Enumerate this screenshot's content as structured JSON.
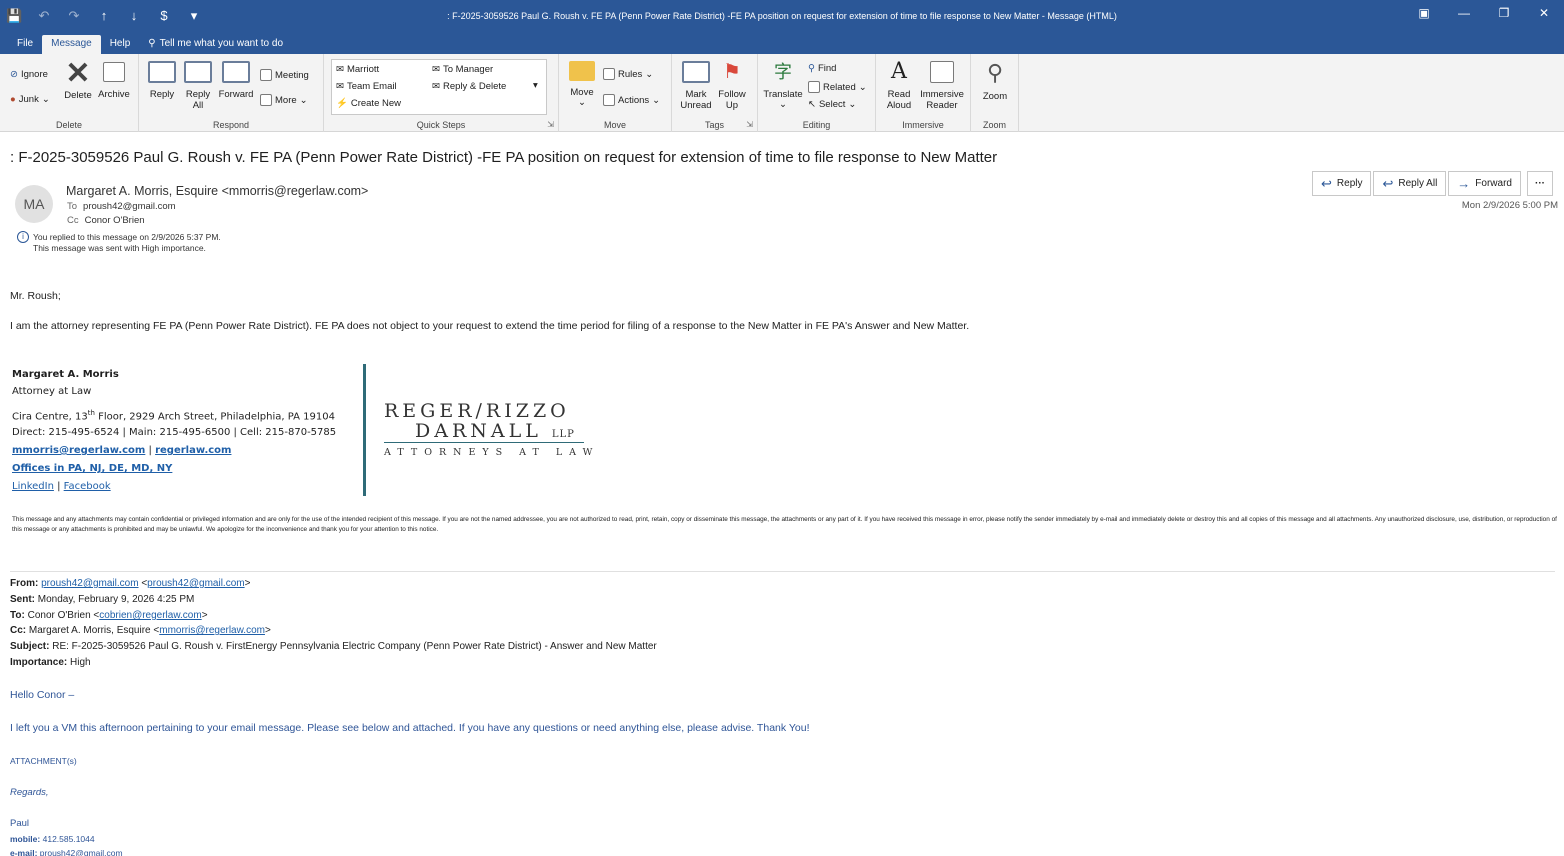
{
  "window": {
    "title": ": F-2025-3059526 Paul G. Roush v. FE PA (Penn Power Rate District) -FE PA position on  request for extension of time to file response to New Matter  -  Message (HTML)"
  },
  "tabs": [
    "File",
    "Message",
    "Help",
    "Tell me what you want to do"
  ],
  "ribbon": {
    "delete": {
      "ignore": "Ignore",
      "junk": "Junk",
      "delete": "Delete",
      "archive": "Archive",
      "label": "Delete"
    },
    "respond": {
      "reply": "Reply",
      "reply_all_1": "Reply",
      "reply_all_2": "All",
      "forward": "Forward",
      "meeting": "Meeting",
      "more": "More",
      "label": "Respond"
    },
    "quick_steps": {
      "marriott": "Marriott",
      "team_email": "Team Email",
      "create_new": "Create New",
      "to_manager": "To Manager",
      "reply_delete": "Reply & Delete",
      "label": "Quick Steps"
    },
    "move": {
      "move": "Move",
      "rules": "Rules",
      "actions": "Actions",
      "label": "Move"
    },
    "tags": {
      "mark_1": "Mark",
      "mark_2": "Unread",
      "follow_1": "Follow",
      "follow_2": "Up",
      "label": "Tags"
    },
    "editing": {
      "translate": "Translate",
      "find": "Find",
      "related": "Related",
      "select": "Select",
      "label": "Editing"
    },
    "immersive": {
      "read_1": "Read",
      "read_2": "Aloud",
      "imm_1": "Immersive",
      "imm_2": "Reader",
      "label": "Immersive"
    },
    "zoom": {
      "zoom": "Zoom",
      "label": "Zoom"
    }
  },
  "message": {
    "subject": ": F-2025-3059526 Paul G. Roush v. FE PA (Penn Power Rate District) -FE PA position on  request for extension of time to file response to New Matter",
    "avatar_initials": "MA",
    "sender": "Margaret A. Morris, Esquire <mmorris@regerlaw.com>",
    "to_label": "To",
    "to": "proush42@gmail.com",
    "cc_label": "Cc",
    "cc": "Conor O'Brien",
    "info_replied": "You replied to this message on 2/9/2026 5:37 PM.",
    "info_importance": "This message was sent with High importance.",
    "actions": {
      "reply": "Reply",
      "reply_all": "Reply All",
      "forward": "Forward",
      "more": "···"
    },
    "datetime": "Mon 2/9/2026 5:00 PM"
  },
  "body": {
    "greeting": "Mr. Roush;",
    "para1": "I am the attorney representing FE PA (Penn Power Rate District).  FE PA does not object to your request to extend the time period for filing of a response to the New Matter in FE PA's Answer and New Matter.",
    "signature": {
      "name": "Margaret A. Morris",
      "role": "Attorney at Law",
      "addr_pre": "Cira Centre, 13",
      "addr_sup": "th",
      "addr_post": " Floor, 2929 Arch Street, Philadelphia, PA 19104",
      "phones": "Direct: 215-495-6524 | Main: 215-495-6500 | Cell: 215-870-5785",
      "email": "mmorris@regerlaw.com",
      "sep": " | ",
      "site": "regerlaw.com",
      "offices": "Offices in PA, NJ, DE, MD, NY",
      "linkedin": "LinkedIn",
      "facebook": "Facebook"
    },
    "logo": {
      "line1": "REGER∕RIZZO",
      "line2": "DARNALL",
      "llp": "LLP",
      "line3": "ATTORNEYS AT LAW"
    },
    "disclaimer": "This message and any attachments may contain confidential or privileged information and are only for the use of the intended recipient of this message. If you are not the named addressee, you are not authorized to read, print, retain, copy or disseminate this message, the attachments or any part of it. If you have received this message in error, please notify the sender immediately by e-mail and immediately delete or destroy this and all copies of this message and all attachments. Any unauthorized disclosure, use, distribution, or reproduction of this message or any attachments is prohibited and may be unlawful. We apologize for the inconvenience and thank you for your attention to this notice."
  },
  "quoted": {
    "from_label": "From:",
    "from_link": "proush42@gmail.com",
    "from_mid": " <",
    "from_link2": "proush42@gmail.com",
    "from_end": ">",
    "sent_label": "Sent:",
    "sent": "Monday, February 9, 2026 4:25 PM",
    "to_label": "To:",
    "to_pre": "Conor O'Brien <",
    "to_link": "cobrien@regerlaw.com",
    "to_end": ">",
    "cc_label": "Cc:",
    "cc_pre": "Margaret A. Morris, Esquire <",
    "cc_link": "mmorris@regerlaw.com",
    "cc_end": ">",
    "subject_label": "Subject:",
    "subject": "RE: F-2025-3059526 Paul G. Roush v. FirstEnergy Pennsylvania Electric Company (Penn Power Rate District) - Answer and New Matter",
    "importance_label": "Importance:",
    "importance": "High",
    "hello": "Hello Conor –",
    "para": "I left you a VM this afternoon pertaining to your email message.  Please see below and attached.  If you have any questions or need anything else, please advise.  Thank You!",
    "attachments": "ATTACHMENT(s)",
    "regards": "Regards,",
    "name": "Paul",
    "mobile_label": "mobile:",
    "mobile": "412.585.1044",
    "email_label": "e-mail:",
    "email": "proush42@gmail.com"
  }
}
